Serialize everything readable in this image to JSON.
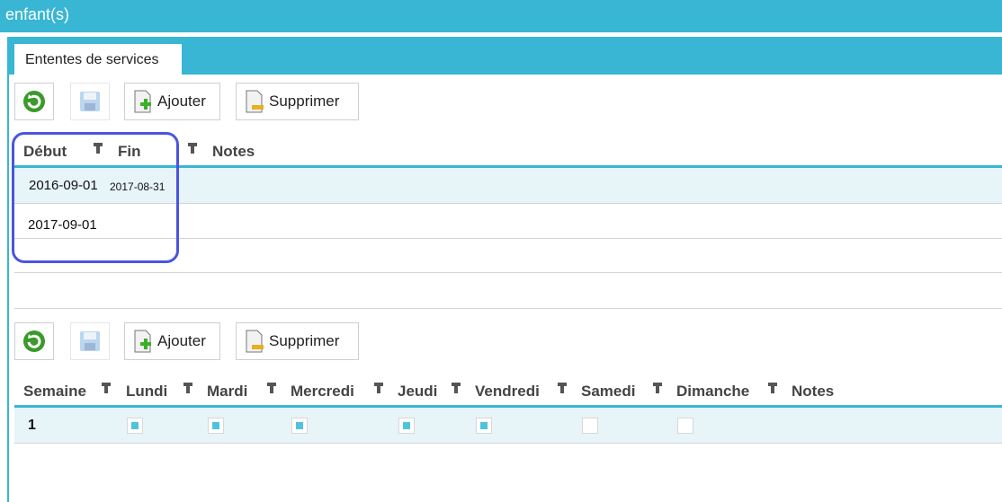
{
  "window": {
    "title": "enfant(s)"
  },
  "tab": {
    "label": "Ententes de services"
  },
  "toolbar": {
    "refresh_icon": "refresh-icon",
    "save_icon": "save-icon",
    "add_label": "Ajouter",
    "delete_label": "Supprimer"
  },
  "agreements": {
    "columns": [
      "Début",
      "Fin",
      "Notes"
    ],
    "rows": [
      {
        "start": "2016-09-01",
        "end": "2017-08-31",
        "notes": ""
      },
      {
        "start": "2017-09-01",
        "end": "",
        "notes": ""
      }
    ]
  },
  "schedule": {
    "columns": [
      "Semaine",
      "Lundi",
      "Mardi",
      "Mercredi",
      "Jeudi",
      "Vendredi",
      "Samedi",
      "Dimanche",
      "Notes"
    ],
    "rows": [
      {
        "week": "1",
        "days": [
          true,
          true,
          true,
          true,
          true,
          false,
          false
        ],
        "notes": ""
      }
    ]
  },
  "colors": {
    "accent": "#38b6d4",
    "highlight": "#4a55e0",
    "checked": "#4fc3dd"
  }
}
